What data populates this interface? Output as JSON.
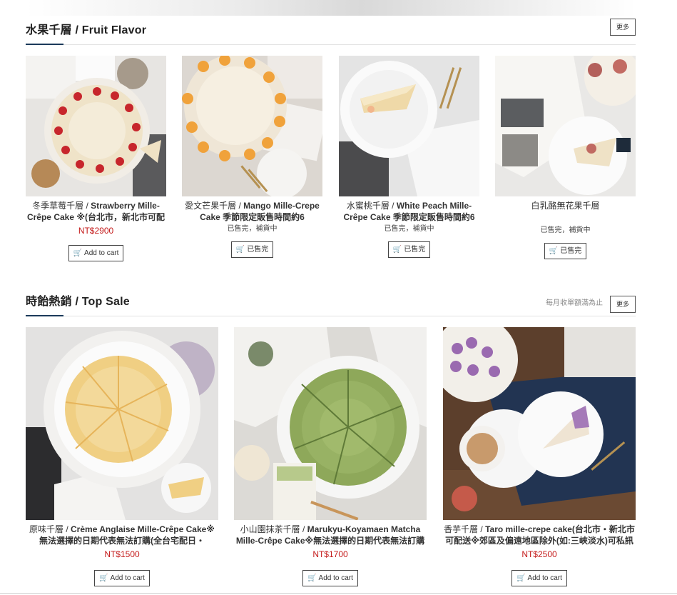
{
  "colors": {
    "accent": "#1b3a5a",
    "price": "#c41a1a"
  },
  "fruit": {
    "title": "水果千層 / Fruit Flavor",
    "more": "更多",
    "products": [
      {
        "name_zh": "冬季草莓千層 / ",
        "name_en": "Strawberry Mille-Crêpe Cake ※(台北市，新北市可配",
        "price": "NT$2900",
        "status": "",
        "button": "Add to cart"
      },
      {
        "name_zh": "愛文芒果千層 / ",
        "name_en": "Mango Mille-Crepe Cake 季節限定販售時間約6",
        "price": "",
        "status": "已售完，補貨中",
        "button": "已售完"
      },
      {
        "name_zh": "水蜜桃千層 / ",
        "name_en": "White Peach Mille-Crêpe Cake 季節限定販售時間約6",
        "price": "",
        "status": "已售完，補貨中",
        "button": "已售完"
      },
      {
        "name_zh": "白乳酪無花果千層",
        "name_en": "",
        "price": "",
        "status": "已售完，補貨中",
        "button": "已售完"
      }
    ]
  },
  "topsale": {
    "title": "時飴熱銷 / Top Sale",
    "note": "每月收單額滿為止",
    "more": "更多",
    "products": [
      {
        "name_zh": "原味千層 / ",
        "name_en": "Crème Anglaise Mille-Crêpe Cake※無法選擇的日期代表無法訂購(全台宅配日・",
        "price": "NT$1500",
        "button": "Add to cart"
      },
      {
        "name_zh": "小山園抹茶千層 / ",
        "name_en": "Marukyu-Koyamaen Matcha Mille-Crêpe Cake※無法選擇的日期代表無法訂購",
        "price": "NT$1700",
        "button": "Add to cart"
      },
      {
        "name_zh": "香芋千層 / ",
        "name_en": "Taro mille-crepe cake(台北市・新北市可配送※郊區及偏遠地區除外(如:三峽淡水)可私訊",
        "price": "NT$2500",
        "button": "Add to cart"
      }
    ]
  }
}
